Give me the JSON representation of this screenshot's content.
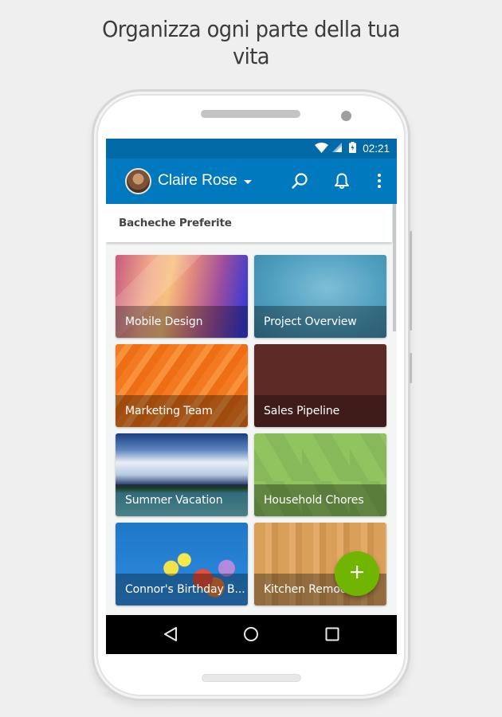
{
  "promo": {
    "headline_line1": "Organizza ogni parte della tua",
    "headline_line2": "vita"
  },
  "status_bar": {
    "icons": [
      "wifi-icon",
      "cellular-signal-icon",
      "battery-charging-icon"
    ],
    "time": "02:21"
  },
  "app_bar": {
    "account_name": "Claire Rose",
    "account_dropdown_icon": "caret-down-icon",
    "actions": [
      {
        "name": "search",
        "icon": "search-icon"
      },
      {
        "name": "notifications",
        "icon": "bell-icon"
      },
      {
        "name": "more",
        "icon": "more-vert-icon"
      }
    ],
    "color": "#0079bf",
    "status_color": "#026aa7"
  },
  "section": {
    "title": "Bacheche Preferite"
  },
  "boards": [
    {
      "title": "Mobile Design"
    },
    {
      "title": "Project Overview"
    },
    {
      "title": "Marketing Team"
    },
    {
      "title": "Sales Pipeline"
    },
    {
      "title": "Summer Vacation"
    },
    {
      "title": "Household Chores"
    },
    {
      "title": "Connor's Birthday B..."
    },
    {
      "title": "Kitchen Remodel"
    }
  ],
  "fab": {
    "icon": "plus-icon",
    "color": "#70b500"
  },
  "nav_bar": {
    "buttons": [
      "back-icon",
      "home-icon",
      "recents-icon"
    ]
  }
}
